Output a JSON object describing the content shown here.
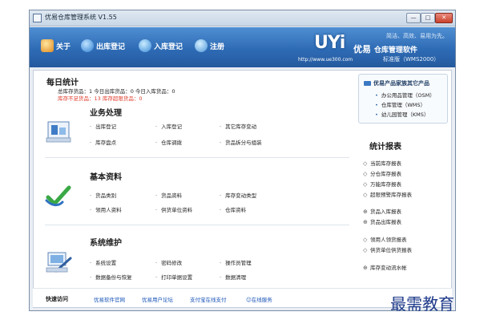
{
  "window": {
    "title": "优易仓库管理系统 V1.55"
  },
  "toolbar": {
    "items": [
      {
        "label": "关于",
        "icon": "home-icon"
      },
      {
        "label": "出库登记",
        "icon": "outbound-icon"
      },
      {
        "label": "入库登记",
        "icon": "inbound-icon"
      },
      {
        "label": "注册",
        "icon": "register-icon"
      }
    ]
  },
  "brand": {
    "logo": "UYi",
    "name": "优易",
    "name_sub": "仓库管理软件",
    "slogan": "简洁、高效、易用为先。",
    "url": "http://www.ue300.com",
    "edition": "标准版（WMS2000）"
  },
  "daily": {
    "title": "每日统计",
    "line1": "总库存货品：1   今日出库货品：0   今日入库货品：0",
    "line2": "库存不足货品：13   库存超限货品：0"
  },
  "business": {
    "title": "业务处理",
    "items": [
      "出库登记",
      "入库登记",
      "其它库存变动",
      "库存盘点",
      "仓库调拨",
      "货品拆分与组装"
    ]
  },
  "basic": {
    "title": "基本资料",
    "items": [
      "货品类别",
      "货品资料",
      "库存变动类型",
      "领用人资料",
      "供货单位资料",
      "仓库资料"
    ]
  },
  "system": {
    "title": "系统维护",
    "items": [
      "系统设置",
      "密码修改",
      "操作员管理",
      "数据备份与恢复",
      "打印单据设置",
      "数据清理"
    ]
  },
  "products": {
    "title": "优易产品家族其它产品",
    "items": [
      "办公用品管理（OSM）",
      "仓库管理（WMS）",
      "幼儿园管理（KMS）"
    ]
  },
  "reports": {
    "title": "统计报表",
    "items": [
      {
        "marker": "◇",
        "label": "当前库存报表"
      },
      {
        "marker": "◇",
        "label": "分仓库存报表"
      },
      {
        "marker": "◇",
        "label": "万能库存报表"
      },
      {
        "marker": "◇",
        "label": "超限预警库存报表"
      },
      {
        "marker": "⊕",
        "label": "货品入库报表"
      },
      {
        "marker": "⊕",
        "label": "货品出库报表"
      },
      {
        "marker": "◇",
        "label": "领用人领货报表"
      },
      {
        "marker": "◇",
        "label": "供货单位供货报表"
      },
      {
        "marker": "⊕",
        "label": "库存变动流水帐"
      }
    ]
  },
  "footer": {
    "label": "快速访问",
    "links": [
      "优易软件官网",
      "优易用户论坛",
      "支付宝在线支付",
      "在线服务"
    ]
  },
  "watermark": "最需教育"
}
